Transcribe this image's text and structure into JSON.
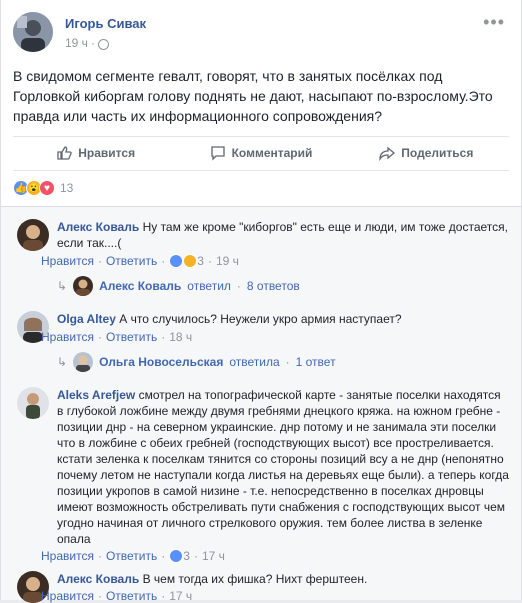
{
  "post": {
    "author": "Игорь Сивак",
    "time": "19 ч",
    "text": "В свидомом сегменте гевалт, говорят, что в занятых посёлках под Горловкой киборгам голову поднять не дают, насыпают по-взрослому.Это правда или часть их информационного сопровождения?",
    "more_icon": "•••"
  },
  "actions": {
    "like": "Нравится",
    "comment": "Комментарий",
    "share": "Поделиться"
  },
  "reactions": {
    "count": "13",
    "colors": {
      "like": "#5890ff",
      "wow": "#f7b125",
      "love": "#f25268"
    }
  },
  "comments": [
    {
      "name": "Алекс Коваль",
      "text": "Ну там же кроме \"киборгов\" есть еще и люди, им тоже достается, если так....(",
      "like": "Нравится",
      "reply": "Ответить",
      "reactions": "3",
      "time": "19 ч",
      "thread": {
        "name": "Алекс Коваль",
        "verb": "ответил",
        "count": "8 ответов"
      }
    },
    {
      "name": "Olga Altey",
      "text": "А что случилось? Неужели укро армия наступает?",
      "like": "Нравится",
      "reply": "Ответить",
      "time": "18 ч",
      "thread": {
        "name": "Ольга Новосельская",
        "verb": "ответила",
        "count": "1 ответ"
      }
    },
    {
      "name": "Aleks Arefjew",
      "text": "смотрел на топографической карте - занятые поселки находятся в глубокой ложбине между двумя гребнями днецкого кряжа. на южном гребне - позиции днр - на северном украинские. днр потому и не занимала эти поселки что в ложбине с обеих гребней (господствующих высот) все простреливается. кстати зеленка к поселкам тянится со стороны позиций всу а не днр (непонятно почему летом не наступали когда листья на деревьях еще были). а теперь когда позиции укропов в самой низине - т.е. непосредственно в поселках днровцы имеют возможность обстреливать пути снабжения с господствующих высот чем угодно начиная от личного стрелкового оружия. тем более листва в зеленке опала",
      "like": "Нравится",
      "reply": "Ответить",
      "reactions": "3",
      "time": "17 ч"
    },
    {
      "name": "Алекс Коваль",
      "text": "В чем тогда их фишка? Нихт ферштеен.",
      "like": "Нравится",
      "reply": "Ответить",
      "time": "17 ч"
    }
  ],
  "separator": "·"
}
